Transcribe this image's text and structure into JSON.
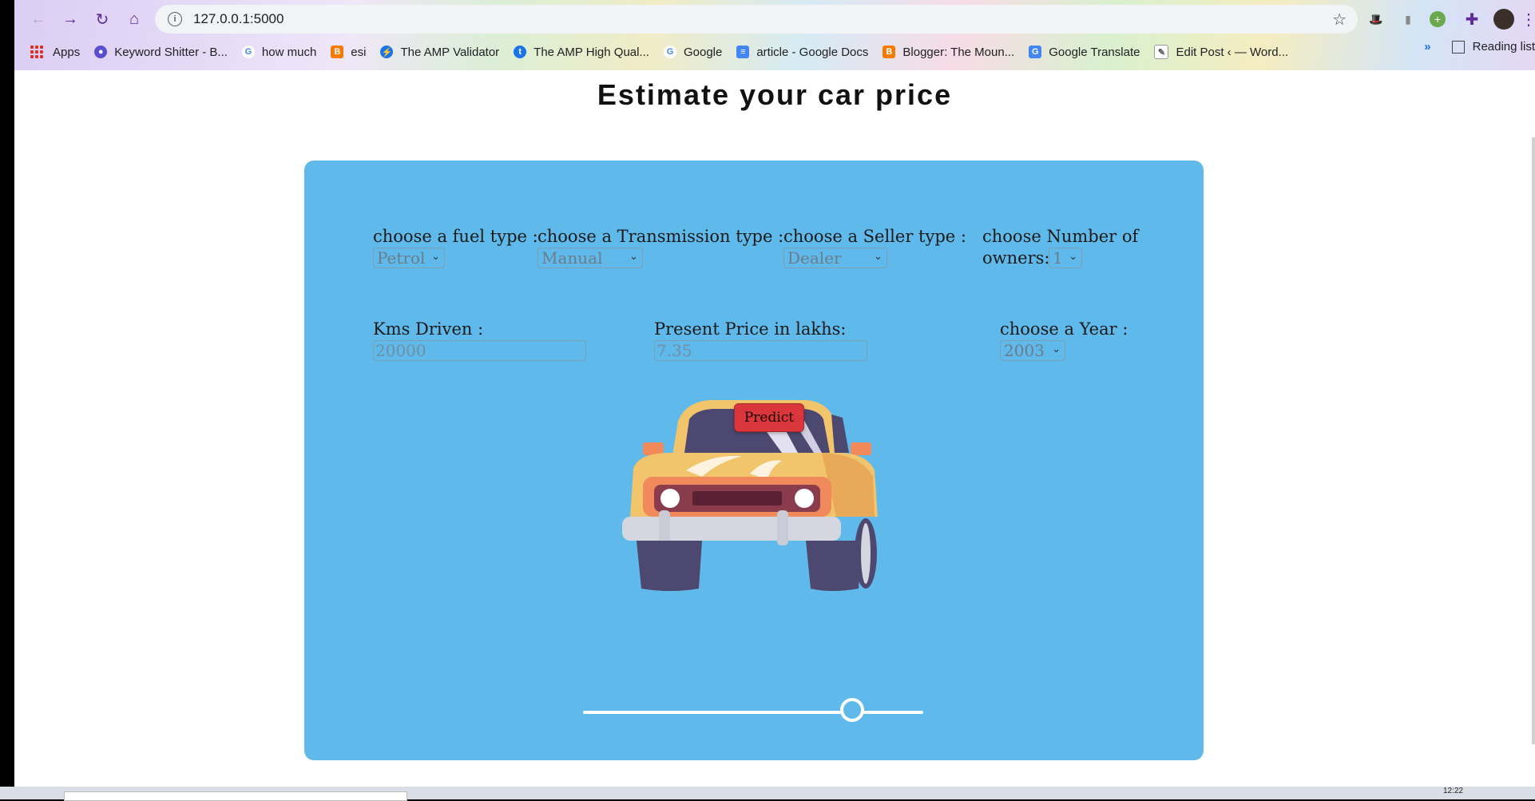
{
  "browser": {
    "url": "127.0.0.1:5000",
    "bookmarks": [
      {
        "label": "Apps",
        "icon": "apps-grid-icon"
      },
      {
        "label": "Keyword Shitter - B...",
        "icon": "globe-icon",
        "color": "#5a4fcf"
      },
      {
        "label": "how much",
        "icon": "google-icon",
        "color": "#4285f4"
      },
      {
        "label": "esi",
        "icon": "blogger-icon",
        "color": "#f57c00"
      },
      {
        "label": "The AMP Validator",
        "icon": "amp-icon",
        "color": "#1a73e8"
      },
      {
        "label": "The AMP High Qual...",
        "icon": "t-icon",
        "color": "#1a73e8"
      },
      {
        "label": "Google",
        "icon": "google-icon",
        "color": "#4285f4"
      },
      {
        "label": "article - Google Docs",
        "icon": "docs-icon",
        "color": "#4285f4"
      },
      {
        "label": "Blogger: The Moun...",
        "icon": "blogger-icon",
        "color": "#f57c00"
      },
      {
        "label": "Google Translate",
        "icon": "translate-icon",
        "color": "#4285f4"
      },
      {
        "label": "Edit Post ‹ — Word...",
        "icon": "edit-post-icon",
        "color": "#555555"
      }
    ],
    "reading_list": "Reading list",
    "more": "»"
  },
  "page": {
    "title": "Estimate your car price"
  },
  "form": {
    "fuel": {
      "label": "choose a fuel type :",
      "selected": "Petrol"
    },
    "transmission": {
      "label": "choose a Transmission type :",
      "selected": "Manual"
    },
    "seller": {
      "label": "choose a Seller type :",
      "selected": "Dealer"
    },
    "owners": {
      "label_line1": "choose Number of",
      "label_line2": "owners:",
      "selected": "1"
    },
    "kms": {
      "label": "Kms Driven :",
      "placeholder": "20000"
    },
    "price": {
      "label": "Present Price in lakhs:",
      "placeholder": "7.35"
    },
    "year": {
      "label": "choose a Year :",
      "selected": "2003"
    },
    "predict_label": "Predict"
  },
  "slider": {
    "value_fraction": 0.79
  },
  "taskbar": {
    "clock": "12:22"
  },
  "colors": {
    "card": "#5fb9ea",
    "predict": "#d9373b",
    "car_body": "#f2c46c"
  }
}
